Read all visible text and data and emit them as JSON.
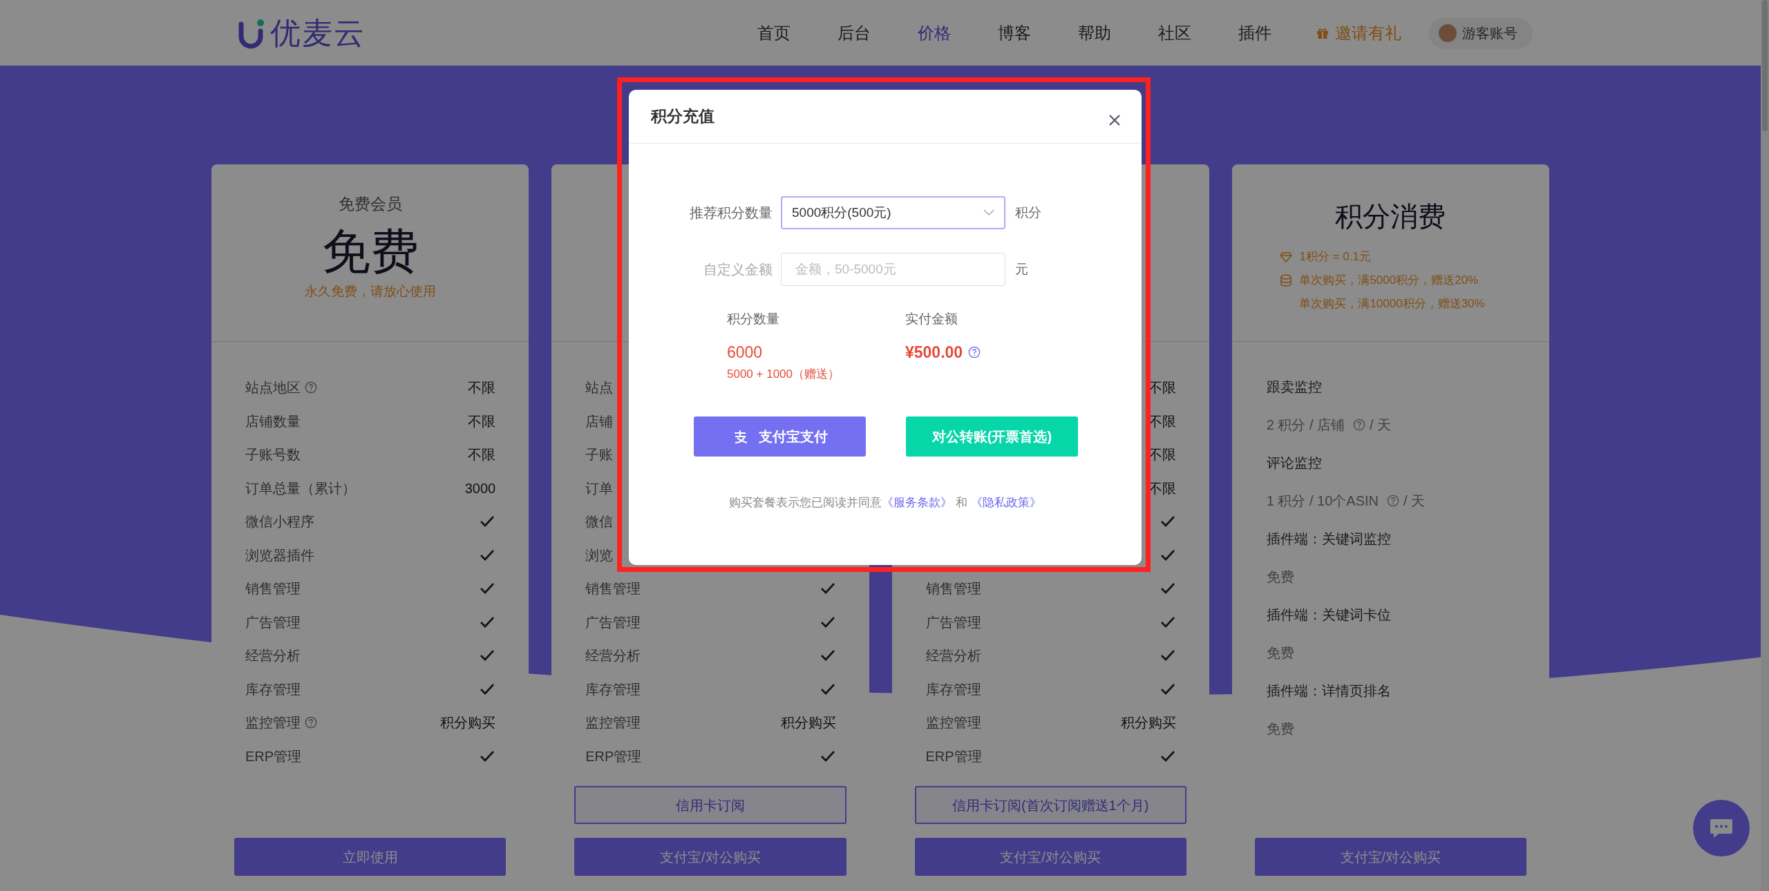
{
  "header": {
    "logo": "优麦云",
    "nav": [
      {
        "label": "首页",
        "selected": false
      },
      {
        "label": "后台",
        "selected": false
      },
      {
        "label": "价格",
        "selected": true
      },
      {
        "label": "博客",
        "selected": false
      },
      {
        "label": "帮助",
        "selected": false
      },
      {
        "label": "社区",
        "selected": false
      },
      {
        "label": "插件",
        "selected": false
      }
    ],
    "invite": "邀请有礼",
    "account": "游客账号"
  },
  "plans": [
    {
      "title": "免费会员",
      "price": "免费",
      "note": "永久免费，请放心使用",
      "features": [
        {
          "label": "站点地区",
          "help": true,
          "kind": "text",
          "value": "不限"
        },
        {
          "label": "店铺数量",
          "kind": "text",
          "value": "不限"
        },
        {
          "label": "子账号数",
          "kind": "text",
          "value": "不限"
        },
        {
          "label": "订单总量（累计）",
          "kind": "text",
          "value": "3000"
        },
        {
          "label": "微信小程序",
          "kind": "check"
        },
        {
          "label": "浏览器插件",
          "kind": "check"
        },
        {
          "label": "销售管理",
          "kind": "check"
        },
        {
          "label": "广告管理",
          "kind": "check"
        },
        {
          "label": "经营分析",
          "kind": "check"
        },
        {
          "label": "库存管理",
          "kind": "check"
        },
        {
          "label": "监控管理",
          "help": true,
          "kind": "text",
          "value": "积分购买"
        },
        {
          "label": "ERP管理",
          "kind": "check"
        }
      ],
      "buttons": [
        {
          "label": "立即使用",
          "kind": "solid"
        }
      ]
    },
    {
      "features": [
        {
          "label": "站点"
        },
        {
          "label": "店铺"
        },
        {
          "label": "子账"
        },
        {
          "label": "订单"
        },
        {
          "label": "微信"
        },
        {
          "label": "浏览"
        },
        {
          "label": "销售管理",
          "kind": "check"
        },
        {
          "label": "广告管理",
          "kind": "check"
        },
        {
          "label": "经营分析",
          "kind": "check"
        },
        {
          "label": "库存管理",
          "kind": "check"
        },
        {
          "label": "监控管理",
          "kind": "text",
          "value": "积分购买"
        },
        {
          "label": "ERP管理",
          "kind": "check"
        }
      ],
      "buttons": [
        {
          "label": "信用卡订阅",
          "kind": "outline"
        },
        {
          "label": "支付宝/对公购买",
          "kind": "solid"
        }
      ]
    },
    {
      "features": [
        {
          "kind": "text",
          "value": "不限"
        },
        {
          "kind": "text",
          "value": "不限"
        },
        {
          "kind": "text",
          "value": "不限"
        },
        {
          "kind": "text",
          "value": "不限"
        },
        {
          "kind": "check"
        },
        {
          "kind": "check"
        },
        {
          "label": "销售管理",
          "kind": "check"
        },
        {
          "label": "广告管理",
          "kind": "check"
        },
        {
          "label": "经营分析",
          "kind": "check"
        },
        {
          "label": "库存管理",
          "kind": "check"
        },
        {
          "label": "监控管理",
          "kind": "text",
          "value": "积分购买"
        },
        {
          "label": "ERP管理",
          "kind": "check"
        }
      ],
      "buttons": [
        {
          "label": "信用卡订阅(首次订阅赠送1个月)",
          "kind": "outline"
        },
        {
          "label": "支付宝/对公购买",
          "kind": "solid"
        }
      ]
    }
  ],
  "points_card": {
    "title": "积分消费",
    "perks": [
      {
        "kind": "diamond",
        "text": "1积分 = 0.1元"
      },
      {
        "kind": "coins",
        "text": "单次购买，满5000积分，赠送20%"
      },
      {
        "kind": "plain",
        "text": "单次购买，满10000积分，赠送30%"
      }
    ],
    "items": [
      {
        "name": "跟卖监控",
        "detail": "2 积分 / 店铺",
        "help": true,
        "suffix": "/ 天"
      },
      {
        "name": "评论监控",
        "detail": "1 积分 / 10个ASIN",
        "help": true,
        "suffix": "/ 天"
      },
      {
        "name": "插件端：关键词监控",
        "detail": "免费"
      },
      {
        "name": "插件端：关键词卡位",
        "detail": "免费"
      },
      {
        "name": "插件端：详情页排名",
        "detail": "免费"
      }
    ],
    "buttons": [
      {
        "label": "支付宝/对公购买",
        "kind": "solid"
      }
    ]
  },
  "modal": {
    "title": "积分充值",
    "recommend": {
      "label": "推荐积分数量",
      "value": "5000积分(500元)",
      "unit": "积分"
    },
    "custom": {
      "label": "自定义金额",
      "placeholder": "金额，50-5000元",
      "unit": "元"
    },
    "points_label": "积分数量",
    "points": "6000",
    "points_detail": "5000 + 1000（赠送）",
    "paid_label": "实付金额",
    "paid": "¥500.00",
    "alipay_button": "支付宝支付",
    "transfer_button": "对公转账(开票首选)",
    "agreement": {
      "text": "购买套餐表示您已阅读并同意",
      "link1": "《服务条款》",
      "joiner": "和",
      "link2": "《隐私政策》"
    }
  }
}
